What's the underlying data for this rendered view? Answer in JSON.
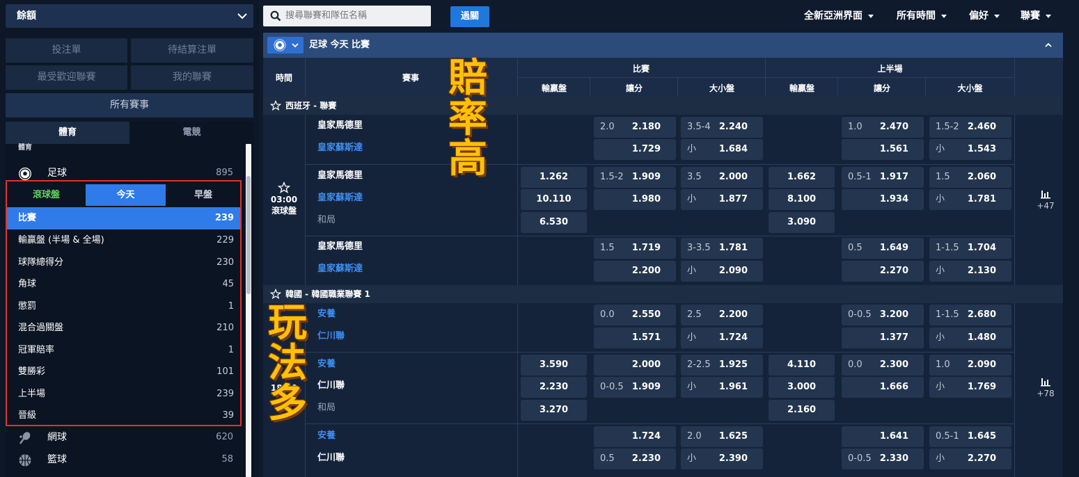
{
  "sidebar": {
    "balance_label": "餘額",
    "buttons": {
      "betslip": "投注單",
      "pending": "待結算注單",
      "popular": "最受歡迎聯賽",
      "my_leagues": "我的聯賽",
      "all_events": "所有賽事"
    },
    "tabs": {
      "sports": "體育",
      "esports": "電競"
    },
    "sports_section_label": "體育",
    "sports": [
      {
        "label": "足球",
        "count": "895",
        "icon": "soccer-ball-icon"
      },
      {
        "label": "網球",
        "count": "620",
        "icon": "tennis-racket-icon"
      },
      {
        "label": "籃球",
        "count": "58",
        "icon": "basketball-icon"
      }
    ],
    "subtabs": {
      "live": "滾球盤",
      "today": "今天",
      "early": "早盤"
    },
    "markets": [
      {
        "label": "比賽",
        "count": "239"
      },
      {
        "label": "輸贏盤 (半場 & 全場)",
        "count": "229"
      },
      {
        "label": "球隊總得分",
        "count": "230"
      },
      {
        "label": "角球",
        "count": "45"
      },
      {
        "label": "懲罰",
        "count": "1"
      },
      {
        "label": "混合過關盤",
        "count": "210"
      },
      {
        "label": "冠軍賠率",
        "count": "1"
      },
      {
        "label": "雙勝彩",
        "count": "101"
      },
      {
        "label": "上半場",
        "count": "239"
      },
      {
        "label": "晉級",
        "count": "39"
      }
    ]
  },
  "topbar": {
    "search_placeholder": "搜尋聯賽和隊伍名稱",
    "filter_button": "過關",
    "menus": [
      "全新亞洲界面",
      "所有時間",
      "偏好",
      "聯賽"
    ]
  },
  "section": {
    "title": "足球 今天 比賽"
  },
  "columns": {
    "time": "時間",
    "event": "賽事",
    "full_time": "比賽",
    "first_half": "上半場",
    "moneyline": "輸贏盤",
    "handicap": "讓分",
    "over_under": "大小盤"
  },
  "leagues": [
    {
      "name": "西班牙 - 聯賽",
      "time": "03:00",
      "status": "滾球盤",
      "more": "+47",
      "home": "皇家馬德里",
      "away": "皇家蘇斯達",
      "draw": "和局",
      "blocks": [
        {
          "ft_hdp": [
            {
              "h": "2.0",
              "o": "2.180"
            },
            {
              "h": "",
              "o": "1.729"
            }
          ],
          "ft_ou": [
            {
              "h": "3.5-4",
              "o": "2.240"
            },
            {
              "h": "小",
              "o": "1.684"
            }
          ],
          "fh_hdp": [
            {
              "h": "1.0",
              "o": "2.470"
            },
            {
              "h": "",
              "o": "1.561"
            }
          ],
          "fh_ou": [
            {
              "h": "1.5-2",
              "o": "2.460"
            },
            {
              "h": "小",
              "o": "1.543"
            }
          ]
        },
        {
          "ft_ml": [
            "1.262",
            "10.110",
            "6.530"
          ],
          "ft_hdp": [
            {
              "h": "1.5-2",
              "o": "1.909"
            },
            {
              "h": "",
              "o": "1.980"
            }
          ],
          "ft_ou": [
            {
              "h": "3.5",
              "o": "2.000"
            },
            {
              "h": "小",
              "o": "1.877"
            }
          ],
          "fh_ml": [
            "1.662",
            "8.100",
            "3.090"
          ],
          "fh_hdp": [
            {
              "h": "0.5-1",
              "o": "1.917"
            },
            {
              "h": "",
              "o": "1.934"
            }
          ],
          "fh_ou": [
            {
              "h": "1.5",
              "o": "2.060"
            },
            {
              "h": "小",
              "o": "1.781"
            }
          ]
        },
        {
          "ft_hdp": [
            {
              "h": "1.5",
              "o": "1.719"
            },
            {
              "h": "",
              "o": "2.200"
            }
          ],
          "ft_ou": [
            {
              "h": "3-3.5",
              "o": "1.781"
            },
            {
              "h": "小",
              "o": "2.090"
            }
          ],
          "fh_hdp": [
            {
              "h": "0.5",
              "o": "1.649"
            },
            {
              "h": "",
              "o": "2.270"
            }
          ],
          "fh_ou": [
            {
              "h": "1-1.5",
              "o": "1.704"
            },
            {
              "h": "小",
              "o": "2.130"
            }
          ]
        }
      ]
    },
    {
      "name": "韓國 - 韓國職業聯賽 1",
      "time_partial": "18:00",
      "more": "+78",
      "home": "安養",
      "away": "仁川聯",
      "draw": "和局",
      "blocks": [
        {
          "ft_hdp": [
            {
              "h": "0.0",
              "o": "2.550"
            },
            {
              "h": "",
              "o": "1.571"
            }
          ],
          "ft_ou": [
            {
              "h": "2.5",
              "o": "2.200"
            },
            {
              "h": "小",
              "o": "1.724"
            }
          ],
          "fh_hdp": [
            {
              "h": "0-0.5",
              "o": "3.200"
            },
            {
              "h": "",
              "o": "1.377"
            }
          ],
          "fh_ou": [
            {
              "h": "1-1.5",
              "o": "2.680"
            },
            {
              "h": "小",
              "o": "1.480"
            }
          ]
        },
        {
          "ft_ml": [
            "3.590",
            "2.230",
            "3.270"
          ],
          "ft_hdp": [
            {
              "h": "",
              "o": "2.000"
            },
            {
              "h": "0-0.5",
              "o": "1.909"
            }
          ],
          "ft_ou": [
            {
              "h": "2-2.5",
              "o": "1.925"
            },
            {
              "h": "小",
              "o": "1.961"
            }
          ],
          "fh_ml": [
            "4.110",
            "3.000",
            "2.160"
          ],
          "fh_hdp": [
            {
              "h": "0.0",
              "o": "2.300"
            },
            {
              "h": "",
              "o": "1.666"
            }
          ],
          "fh_ou": [
            {
              "h": "1.0",
              "o": "2.090"
            },
            {
              "h": "小",
              "o": "1.769"
            }
          ]
        },
        {
          "ft_hdp": [
            {
              "h": "",
              "o": "1.724"
            },
            {
              "h": "0.5",
              "o": "2.230"
            }
          ],
          "ft_ou": [
            {
              "h": "2.0",
              "o": "1.625"
            },
            {
              "h": "小",
              "o": "2.390"
            }
          ],
          "fh_hdp": [
            {
              "h": "",
              "o": "1.641"
            },
            {
              "h": "0-0.5",
              "o": "2.330"
            }
          ],
          "fh_ou": [
            {
              "h": "0.5-1",
              "o": "1.645"
            },
            {
              "h": "小",
              "o": "2.270"
            }
          ]
        }
      ]
    }
  ],
  "promo": {
    "high_odds": [
      "賠",
      "率",
      "高"
    ],
    "many_bets": [
      "玩",
      "法",
      "多"
    ]
  },
  "colors": {
    "accent_blue": "#2f6fd0",
    "selected": "#2f7bea",
    "live_green": "#5fd05f",
    "highlight_red": "#e0322c",
    "promo_gold": "#ffc107"
  }
}
